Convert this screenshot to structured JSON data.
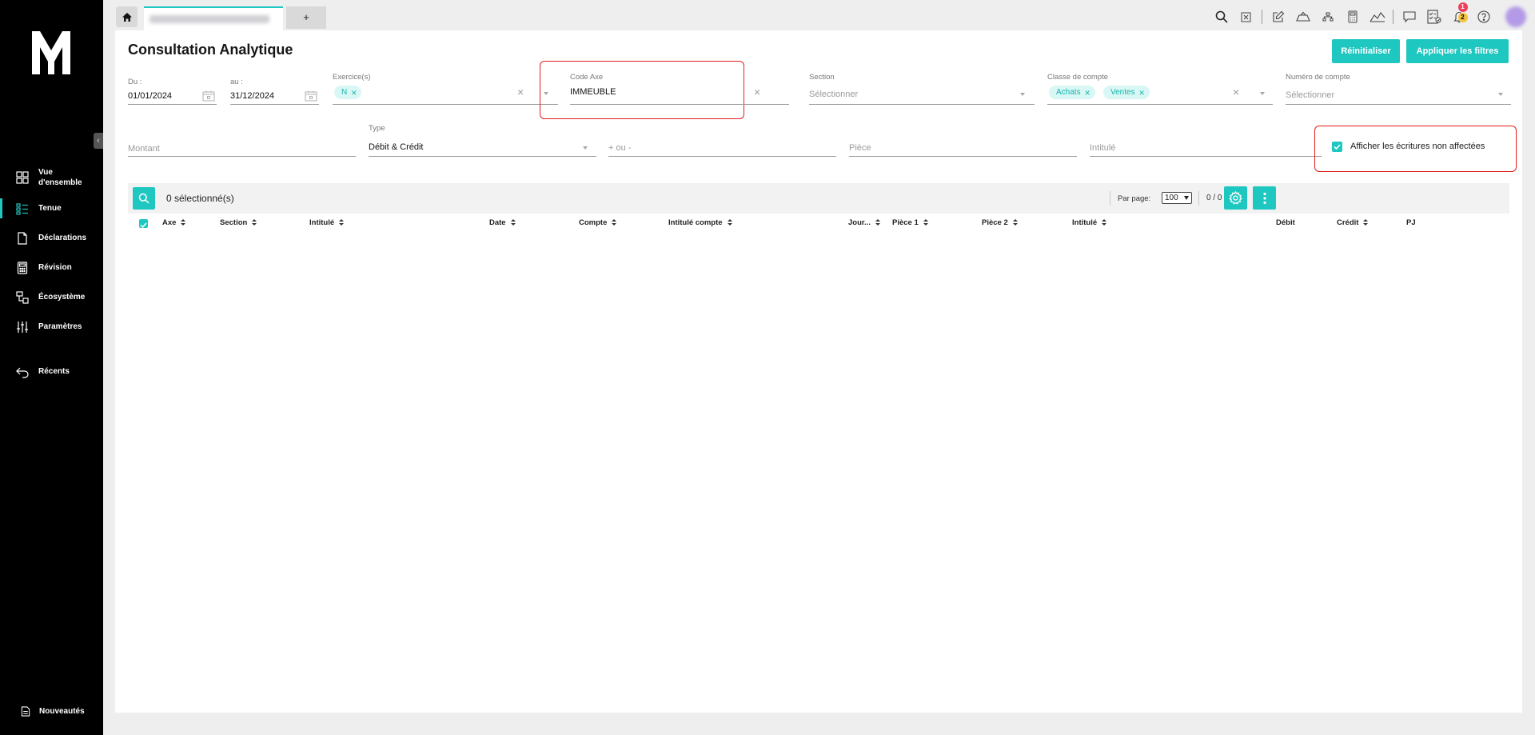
{
  "app": {
    "brand_colors": {
      "accent": "#1fc7c1",
      "sidebar_bg": "#000000",
      "highlight": "#e21e1e",
      "badge_red": "#ef3f5b",
      "badge_yellow": "#f5c33b"
    }
  },
  "sidebar": {
    "logo_icon": "m-logo-icon",
    "items": [
      {
        "label": "Vue d'ensemble",
        "icon": "dashboard-grid-icon",
        "active": false
      },
      {
        "label": "Tenue",
        "icon": "list-icon",
        "active": true
      },
      {
        "label": "Déclarations",
        "icon": "document-icon",
        "active": false
      },
      {
        "label": "Révision",
        "icon": "calculator-icon",
        "active": false
      },
      {
        "label": "Écosystème",
        "icon": "ecosystem-icon",
        "active": false
      },
      {
        "label": "Paramètres",
        "icon": "sliders-icon",
        "active": false
      }
    ],
    "recents": {
      "label": "Récents",
      "icon": "back-arrow-icon"
    },
    "news": {
      "label": "Nouveautés",
      "icon": "news-icon"
    }
  },
  "tabs": {
    "home_icon": "home-icon",
    "add_label": "+"
  },
  "toolbar": {
    "icons": [
      "search-icon",
      "excel-icon",
      "edit-icon",
      "cloud-upload-icon",
      "network-icon",
      "calculator-icon",
      "chart-icon",
      "chat-icon",
      "checklist-icon",
      "bell-icon",
      "help-icon"
    ],
    "notifications_red": "1",
    "notifications_yellow": "2"
  },
  "page": {
    "title": "Consultation Analytique",
    "reset_label": "Réinitialiser",
    "apply_label": "Appliquer les filtres"
  },
  "filters": {
    "du": {
      "label": "Du :",
      "value": "01/01/2024"
    },
    "au": {
      "label": "au :",
      "value": "31/12/2024"
    },
    "exercice": {
      "label": "Exercice(s)",
      "chips": [
        "N"
      ]
    },
    "code_axe": {
      "label": "Code Axe",
      "value": "IMMEUBLE"
    },
    "section": {
      "label": "Section",
      "placeholder": "Sélectionner"
    },
    "classe_compte": {
      "label": "Classe de compte",
      "chips": [
        "Achats",
        "Ventes"
      ]
    },
    "numero_compte": {
      "label": "Numéro de compte",
      "placeholder": "Sélectionner"
    },
    "montant": {
      "placeholder": "Montant"
    },
    "type": {
      "label": "Type",
      "value": "Débit & Crédit"
    },
    "plus_moins": {
      "placeholder": "+ ou -"
    },
    "piece": {
      "placeholder": "Pièce"
    },
    "intitule": {
      "placeholder": "Intitulé"
    },
    "non_affectees": {
      "label": "Afficher les écritures non affectées",
      "checked": true
    }
  },
  "grid": {
    "selected_count": "0 sélectionné(s)",
    "per_page_label": "Par page:",
    "per_page_value": "100",
    "pager": "0 / 0",
    "columns": [
      "Axe",
      "Section",
      "Intitulé",
      "Date",
      "Compte",
      "Intitulé compte",
      "Jour...",
      "Pièce 1",
      "Pièce 2",
      "Intitulé",
      "Débit",
      "Crédit",
      "PJ"
    ],
    "rows": []
  }
}
